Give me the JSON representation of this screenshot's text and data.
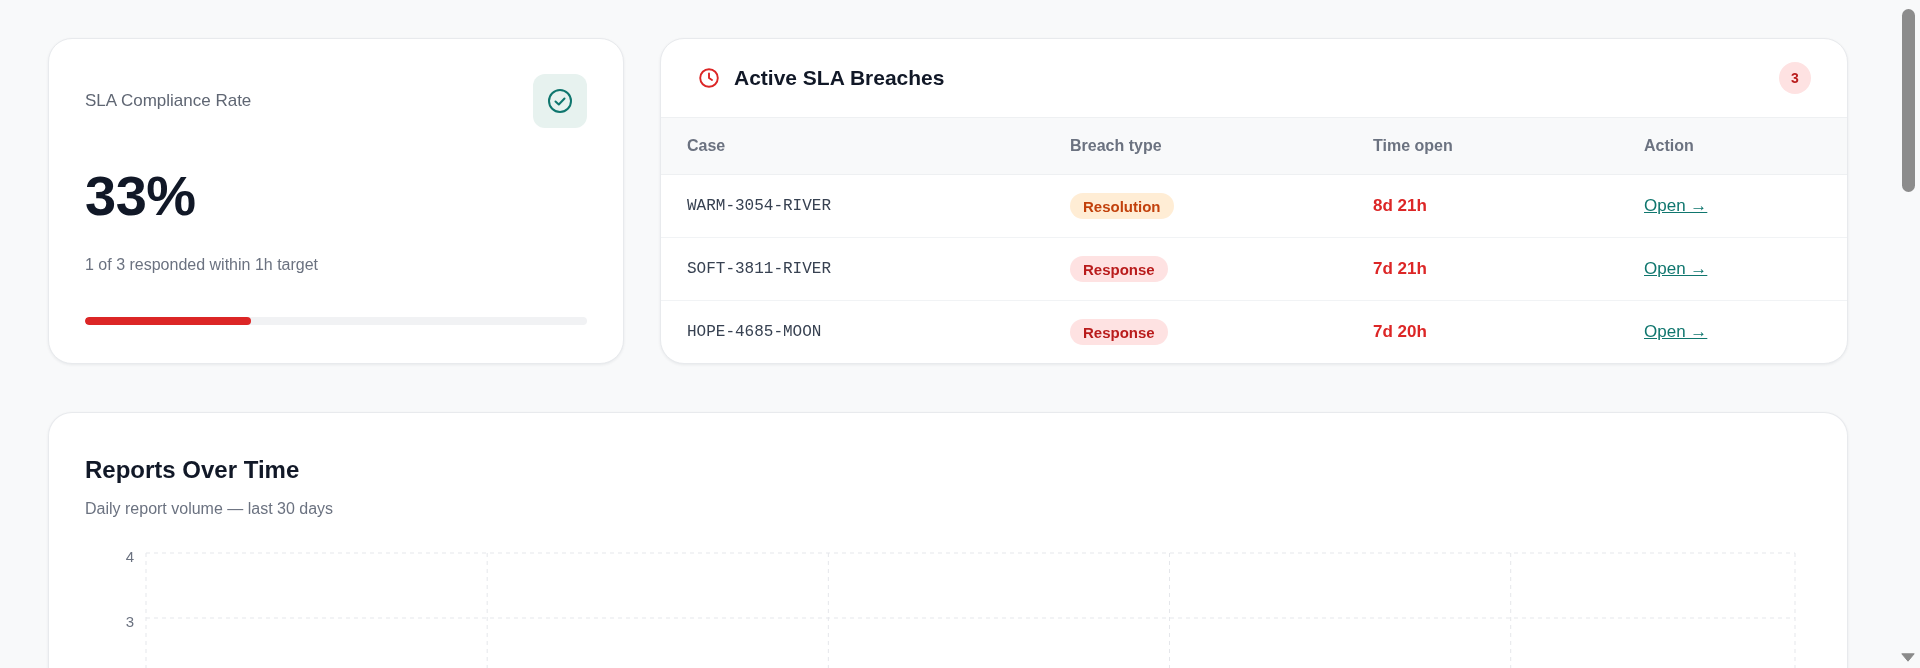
{
  "compliance_card": {
    "title": "SLA Compliance Rate",
    "value": "33%",
    "caption": "1 of 3 responded within 1h target",
    "progress": {
      "level": 0.33
    }
  },
  "breaches_card": {
    "title": "Active SLA Breaches",
    "count": "3",
    "table": {
      "columns": [
        "Case",
        "Breach type",
        "Time open",
        "Action"
      ],
      "rows": [
        {
          "case": "WARM-3054-RIVER",
          "breach_type": {
            "label": "Resolution",
            "kind": "resolution"
          },
          "time_open": "8d 21h",
          "action": "Open →"
        },
        {
          "case": "SOFT-3811-RIVER",
          "breach_type": {
            "label": "Response",
            "kind": "response"
          },
          "time_open": "7d 21h",
          "action": "Open →"
        },
        {
          "case": "HOPE-4685-MOON",
          "breach_type": {
            "label": "Response",
            "kind": "response"
          },
          "time_open": "7d 20h",
          "action": "Open →"
        }
      ]
    }
  },
  "reports_card": {
    "title": "Reports Over Time",
    "subtitle": "Daily report volume — last 30 days",
    "chart": {
      "y_axis_labels": [
        "4",
        "3"
      ]
    }
  }
}
